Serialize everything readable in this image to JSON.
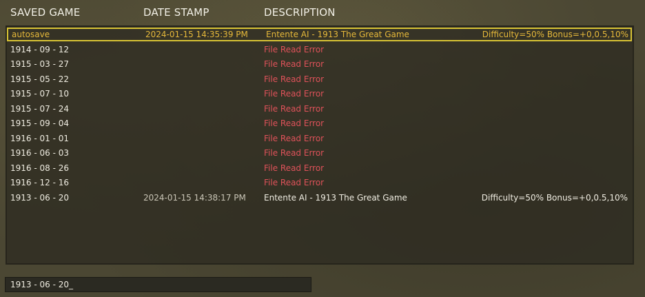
{
  "colors": {
    "normal_text": "#f0ede2",
    "selected_text": "#e6b93a",
    "error_text": "#e0525a",
    "selection_border": "#d8c334",
    "dim_date": "#c9c5b6"
  },
  "columns": {
    "saved_game": "SAVED GAME",
    "date_stamp": "DATE STAMP",
    "description": "DESCRIPTION"
  },
  "rows": [
    {
      "name": "autosave",
      "date": "2024-01-15  14:35:39 PM",
      "description": "Entente AI - 1913 The Great Game",
      "extra": "Difficulty=50%   Bonus=+0,0.5,10%",
      "state": "selected"
    },
    {
      "name": "1914 - 09 - 12",
      "date": "",
      "description": "File Read Error",
      "extra": "",
      "state": "error"
    },
    {
      "name": "1915 - 03 - 27",
      "date": "",
      "description": "File Read Error",
      "extra": "",
      "state": "error"
    },
    {
      "name": "1915 - 05 - 22",
      "date": "",
      "description": "File Read Error",
      "extra": "",
      "state": "error"
    },
    {
      "name": "1915 - 07 - 10",
      "date": "",
      "description": "File Read Error",
      "extra": "",
      "state": "error"
    },
    {
      "name": "1915 - 07 - 24",
      "date": "",
      "description": "File Read Error",
      "extra": "",
      "state": "error"
    },
    {
      "name": "1915 - 09 - 04",
      "date": "",
      "description": "File Read Error",
      "extra": "",
      "state": "error"
    },
    {
      "name": "1916 - 01 - 01",
      "date": "",
      "description": "File Read Error",
      "extra": "",
      "state": "error"
    },
    {
      "name": "1916 - 06 - 03",
      "date": "",
      "description": "File Read Error",
      "extra": "",
      "state": "error"
    },
    {
      "name": "1916 - 08 - 26",
      "date": "",
      "description": "File Read Error",
      "extra": "",
      "state": "error"
    },
    {
      "name": "1916 - 12 - 16",
      "date": "",
      "description": "File Read Error",
      "extra": "",
      "state": "error"
    },
    {
      "name": "1913 - 06 - 20",
      "date": "2024-01-15  14:38:17 PM",
      "description": "Entente AI - 1913 The Great Game",
      "extra": "Difficulty=50%   Bonus=+0,0.5,10%",
      "state": "normal"
    }
  ],
  "filename_input": {
    "value": "1913 - 06 - 20_"
  }
}
